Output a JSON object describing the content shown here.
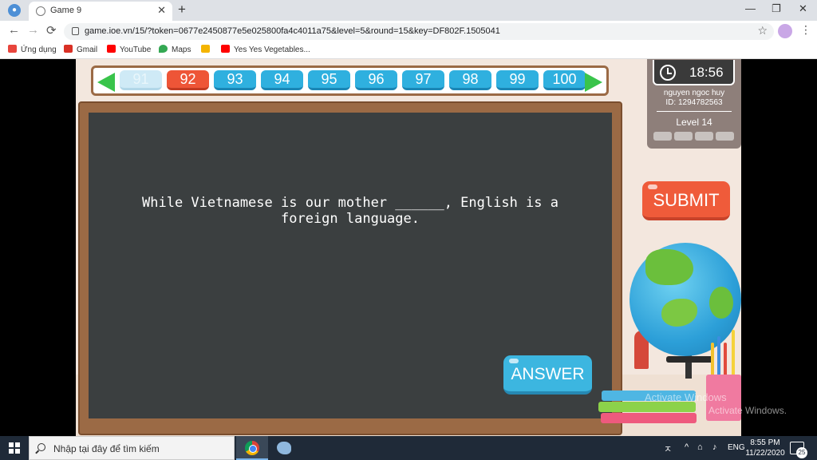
{
  "browser": {
    "tab_title": "Game 9",
    "tab_close": "✕",
    "new_tab": "+",
    "minimize": "—",
    "maximize": "❐",
    "close": "✕",
    "back": "←",
    "forward": "→",
    "reload": "⟳",
    "url": "game.ioe.vn/15/?token=0677e2450877e5e025800fa4c4011a75&level=5&round=15&key=DF802F.1505041",
    "star": "☆",
    "menu": "⋮"
  },
  "bookmarks": [
    {
      "label": "Ứng dụng",
      "color": "#e8453c"
    },
    {
      "label": "Gmail",
      "color": "#d93025"
    },
    {
      "label": "YouTube",
      "color": "#ff0000"
    },
    {
      "label": "Maps",
      "color": "#34a853"
    },
    {
      "label": "",
      "color": "#f4b400"
    },
    {
      "label": "Yes Yes Vegetables...",
      "color": "#ff0000"
    }
  ],
  "rounds": [
    {
      "label": "91",
      "state": "done"
    },
    {
      "label": "92",
      "state": "active"
    },
    {
      "label": "93",
      "state": "pending"
    },
    {
      "label": "94",
      "state": "pending"
    },
    {
      "label": "95",
      "state": "pending"
    },
    {
      "label": "96",
      "state": "pending"
    },
    {
      "label": "97",
      "state": "pending"
    },
    {
      "label": "98",
      "state": "pending"
    },
    {
      "label": "99",
      "state": "pending"
    },
    {
      "label": "100",
      "state": "pending"
    }
  ],
  "question": {
    "line1": "While Vietnamese is our mother ______, English is a",
    "line2": "foreign language."
  },
  "panel": {
    "timer": "18:56",
    "user_name": "nguyen ngoc huy",
    "user_id": "ID: 1294782563",
    "level": "Level 14"
  },
  "buttons": {
    "submit": "SUBMIT",
    "answer": "ANSWER"
  },
  "watermark": {
    "line1": "Activate Windows",
    "line2": "Activate Windows."
  },
  "taskbar": {
    "search_placeholder": "Nhập tại đây để tìm kiếm",
    "tray_user": "ㅈ",
    "tray_chevron": "^",
    "tray_network": "⌂",
    "tray_volume": "♪",
    "language": "ENG",
    "time": "8:55 PM",
    "date": "11/22/2020",
    "notifications": "25"
  },
  "colors": {
    "round_active": "#ee5537",
    "round_pending": "#2fb0df",
    "board": "#3b3f40",
    "frame": "#9b6a45",
    "submit": "#ef5b3a",
    "answer": "#3cb6e0",
    "nav_arrow": "#39c44b"
  }
}
